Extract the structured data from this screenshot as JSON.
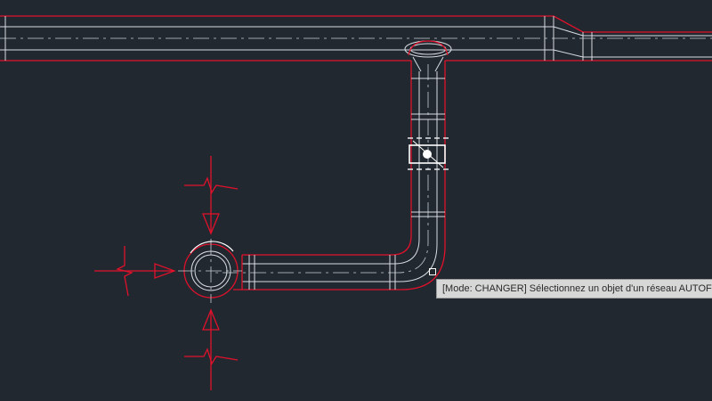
{
  "app": {
    "background": "#212830",
    "accent_red": "#e0112b"
  },
  "prompt": {
    "text": "[Mode: CHANGER] Sélectionnez un objet d'un réseau AUTOFLUID:"
  },
  "cursor": {
    "icon": "pickbox-cursor-icon"
  }
}
